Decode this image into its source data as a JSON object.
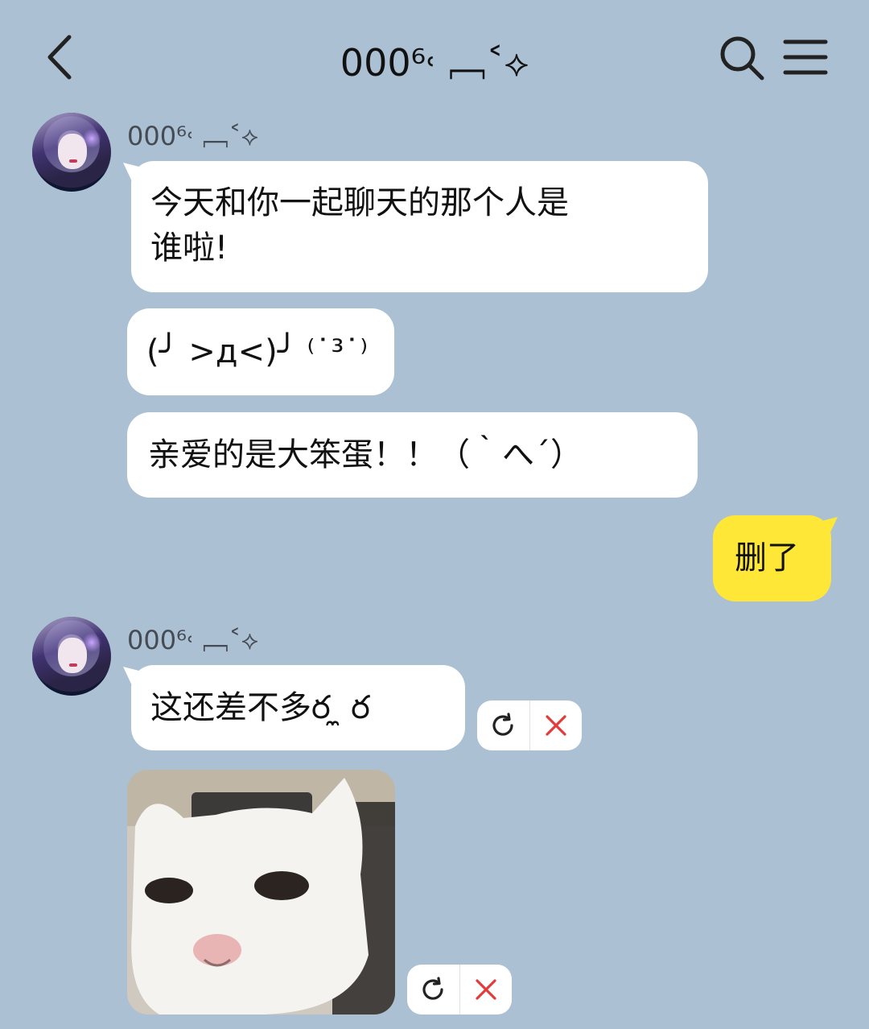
{
  "header": {
    "title": "000⁶˓ ﹇˂⟡"
  },
  "messages": [
    {
      "sender": "000⁶˓ ﹇˂⟡",
      "line1": "今天和你一起聊天的那个人是",
      "line2": "谁啦!"
    },
    {
      "text": "(╯ >д<)╯ ⁽˙³˙⁾"
    },
    {
      "text": "亲爱的是大笨蛋！！（｀へ´）"
    },
    {
      "text": "删了"
    },
    {
      "sender": "000⁶˓ ﹇˂⟡",
      "text": "这还差不多ర ̼ ర"
    }
  ],
  "colors": {
    "background": "#abc0d3",
    "my_bubble": "#ffe738",
    "their_bubble": "#ffffff",
    "close_red": "#e33b3b"
  },
  "icons": [
    "back-arrow-icon",
    "search-icon",
    "menu-icon",
    "retry-icon",
    "close-icon"
  ]
}
